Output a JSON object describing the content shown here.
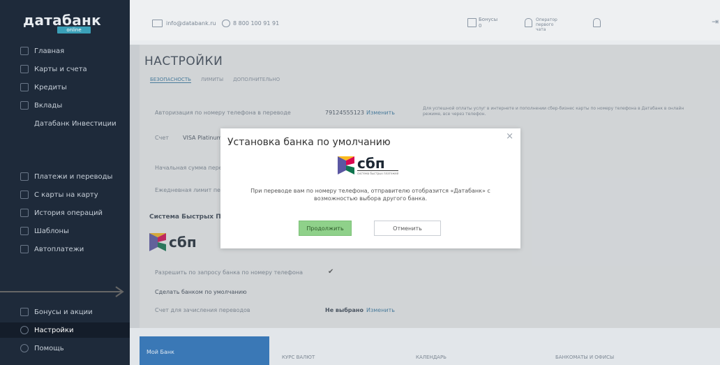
{
  "sidebar": {
    "logo": "датабанк",
    "logo_sub": "online",
    "items": [
      {
        "label": "Главная"
      },
      {
        "label": "Карты и счета"
      },
      {
        "label": "Кредиты"
      },
      {
        "label": "Вклады"
      },
      {
        "label": "Датабанк Инвестиции"
      },
      {
        "label": "Платежи и переводы"
      },
      {
        "label": "С карты на карту"
      },
      {
        "label": "История операций"
      },
      {
        "label": "Шаблоны"
      },
      {
        "label": "Автоплатежи"
      },
      {
        "label": "Бонусы и акции"
      },
      {
        "label": "Настройки"
      },
      {
        "label": "Помощь"
      }
    ]
  },
  "topbar": {
    "email": "info@databank.ru",
    "phone": "8 800 100 91 91",
    "bonus_label": "Бонусы",
    "bonus_count": "0",
    "chat_label": "Оператор первого чата"
  },
  "page": {
    "title": "НАСТРОЙКИ",
    "tabs": [
      "БЕЗОПАСНОСТЬ",
      "ЛИМИТЫ",
      "ДОПОЛНИТЕЛЬНО"
    ],
    "rows": [
      {
        "label": "Авторизация по номеру телефона в переводе",
        "value": "79124555123",
        "action": "Изменить"
      },
      {
        "label": "Счет",
        "value": "VISA Platinum"
      },
      {
        "label": "Начальная сумма перевода"
      },
      {
        "label": "Ежедневная лимит переводов"
      }
    ],
    "info_text": "Для успешной оплаты услуг в интернете и пополнении сбер-бизнес карты по номеру телефона в Датабанк в онлайн режиме, все через телефон.",
    "sbp_section_title": "Система Быстрых Платежей",
    "sbp_rows": [
      {
        "label": "Разрешить по запросу банка по номеру телефона"
      },
      {
        "label": "Сделать банком по умолчанию"
      },
      {
        "label": "Счет для зачисления переводов",
        "value": "Не выбрано",
        "action": "Изменить"
      }
    ]
  },
  "modal": {
    "title": "Установка банка по умолчанию",
    "close": "×",
    "sbp_text": "сбп",
    "sbp_caption": "система быстрых платежей",
    "text": "При переводе вам по номеру телефона, отправителю отобразится «Датабанк» с возможностью выбора другого банка.",
    "confirm": "Продолжить",
    "cancel": "Отменить"
  },
  "bottom": {
    "promo": "Мой Банк",
    "items": [
      "КУРС ВАЛЮТ",
      "КАЛЕНДАРЬ",
      "БАНКОМАТЫ И ОФИСЫ"
    ]
  }
}
